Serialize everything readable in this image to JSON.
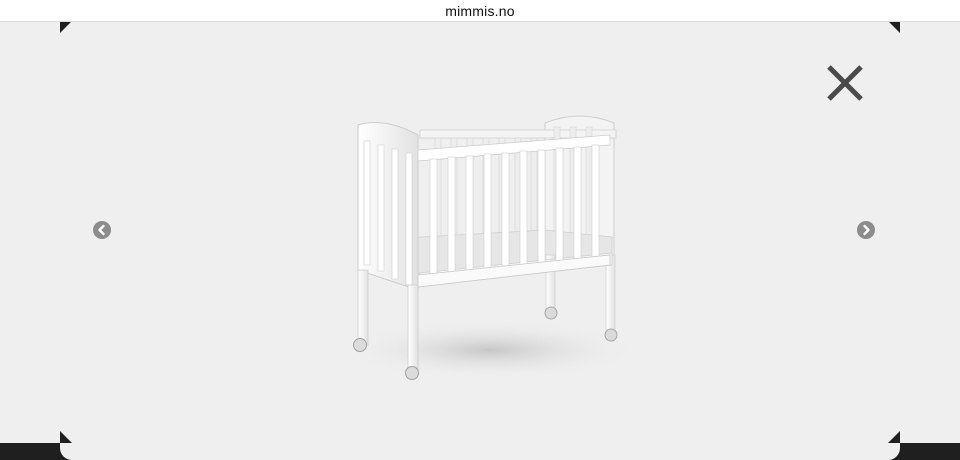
{
  "browser": {
    "url": "mimmis.no"
  },
  "lightbox": {
    "background_color": "#efefef",
    "close_icon": "close-icon",
    "prev_icon": "chevron-left-icon",
    "next_icon": "chevron-right-icon",
    "image_subject": "crib"
  }
}
